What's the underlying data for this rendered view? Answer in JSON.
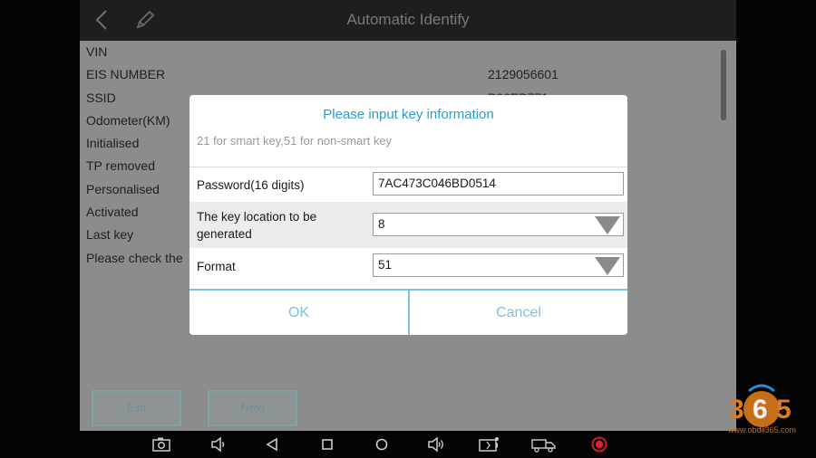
{
  "header": {
    "title": "Automatic Identify",
    "back_icon": "chevron-left-icon",
    "edit_icon": "pencil-icon"
  },
  "info_list": [
    {
      "label": "VIN",
      "value": ""
    },
    {
      "label": "EIS NUMBER",
      "value": "2129056601"
    },
    {
      "label": "SSID",
      "value": "B06EB771"
    },
    {
      "label": "Odometer(KM)",
      "value": ""
    },
    {
      "label": "Initialised",
      "value": ""
    },
    {
      "label": "TP removed",
      "value": ""
    },
    {
      "label": "Personalised",
      "value": ""
    },
    {
      "label": "Activated",
      "value": ""
    },
    {
      "label": "Last key",
      "value": ""
    },
    {
      "label": "Please check the",
      "value": ""
    }
  ],
  "bottom_buttons": {
    "exit": "Exit",
    "next": "Next"
  },
  "dialog": {
    "title": "Please input key information",
    "hint": "21 for smart key,51 for non-smart key",
    "fields": [
      {
        "label": "Password(16 digits)",
        "value": "7AC473C046BD0514",
        "type": "text"
      },
      {
        "label_line1": "The key location to be",
        "label_line2": "generated",
        "value": "8",
        "type": "select"
      },
      {
        "label": "Format",
        "value": "51",
        "type": "select"
      }
    ],
    "ok": "OK",
    "cancel": "Cancel"
  },
  "navbar": {
    "icons": [
      "camera-icon",
      "volume-down-icon",
      "back-triangle-icon",
      "recent-apps-icon",
      "home-icon",
      "volume-up-icon",
      "battery-icon",
      "truck-icon",
      "record-icon"
    ]
  },
  "watermark": {
    "text": "www.obdii365.com"
  },
  "colors": {
    "accent": "#2a9cc7",
    "button_text": "#7ac2df",
    "record": "#e0202a"
  }
}
